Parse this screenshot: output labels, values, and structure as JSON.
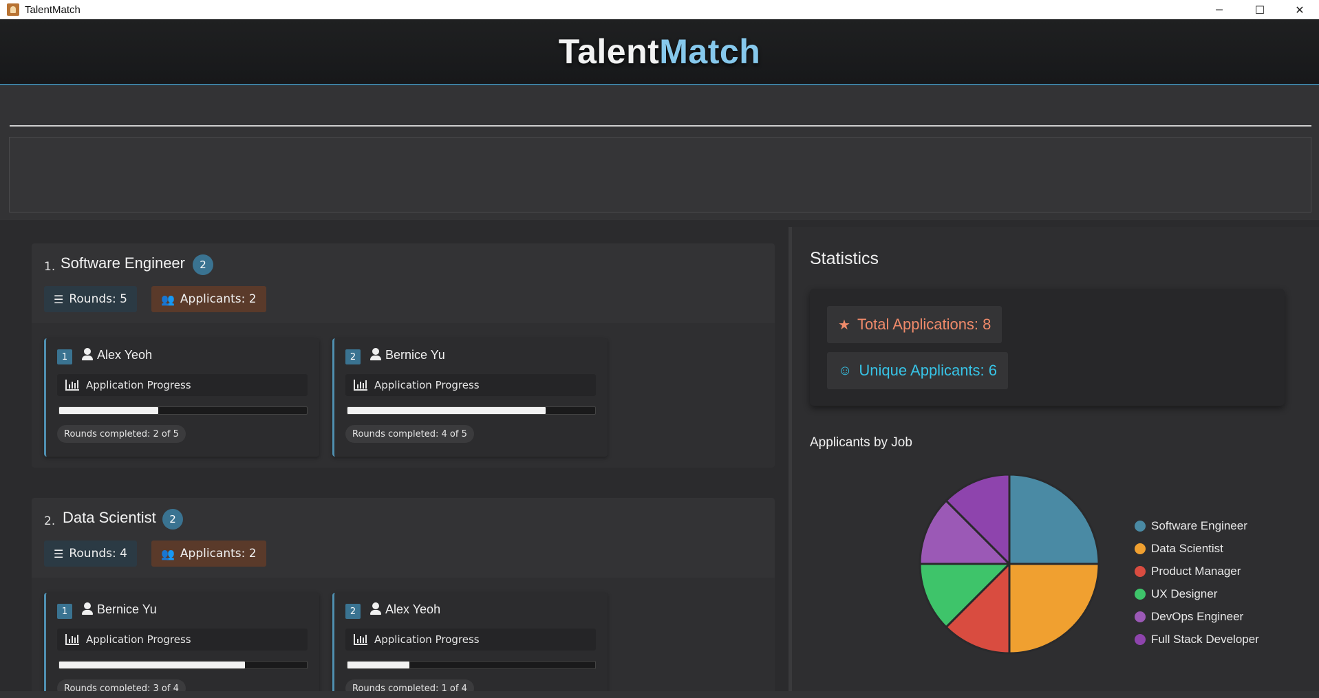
{
  "window": {
    "title": "TalentMatch",
    "controls": {
      "minimize": "─",
      "maximize": "☐",
      "close": "✕"
    }
  },
  "brand": {
    "part1": "Talent",
    "part2": "Match"
  },
  "jobs": [
    {
      "index": "1.",
      "title": "Software Engineer",
      "count": "2",
      "rounds_label": "Rounds: 5",
      "applicants_label": "Applicants: 2",
      "applicants": [
        {
          "idx": "1",
          "name": "Alex Yeoh",
          "progress_label": "Application Progress",
          "progress": 0.4,
          "rounds_text": "Rounds completed: 2 of 5"
        },
        {
          "idx": "2",
          "name": "Bernice Yu",
          "progress_label": "Application Progress",
          "progress": 0.8,
          "rounds_text": "Rounds completed: 4 of 5"
        }
      ]
    },
    {
      "index": "2.",
      "title": "Data Scientist",
      "count": "2",
      "rounds_label": "Rounds: 4",
      "applicants_label": "Applicants: 2",
      "applicants": [
        {
          "idx": "1",
          "name": "Bernice Yu",
          "progress_label": "Application Progress",
          "progress": 0.75,
          "rounds_text": "Rounds completed: 3 of 4"
        },
        {
          "idx": "2",
          "name": "Alex Yeoh",
          "progress_label": "Application Progress",
          "progress": 0.25,
          "rounds_text": "Rounds completed: 1 of 4"
        }
      ]
    }
  ],
  "stats": {
    "title": "Statistics",
    "total_label": "Total Applications: 8",
    "unique_label": "Unique Applicants: 6",
    "total_icon": "★",
    "unique_icon": "☺",
    "pie_title": "Applicants by Job"
  },
  "chart_data": {
    "type": "pie",
    "title": "Applicants by Job",
    "categories": [
      "Software Engineer",
      "Data Scientist",
      "Product Manager",
      "UX Designer",
      "DevOps Engineer",
      "Full Stack Developer"
    ],
    "values": [
      2,
      2,
      1,
      1,
      1,
      1
    ],
    "colors": [
      "#4a8aa4",
      "#f0a030",
      "#d94c40",
      "#3ec46a",
      "#9b59b6",
      "#8e44ad"
    ],
    "legend_position": "right"
  }
}
